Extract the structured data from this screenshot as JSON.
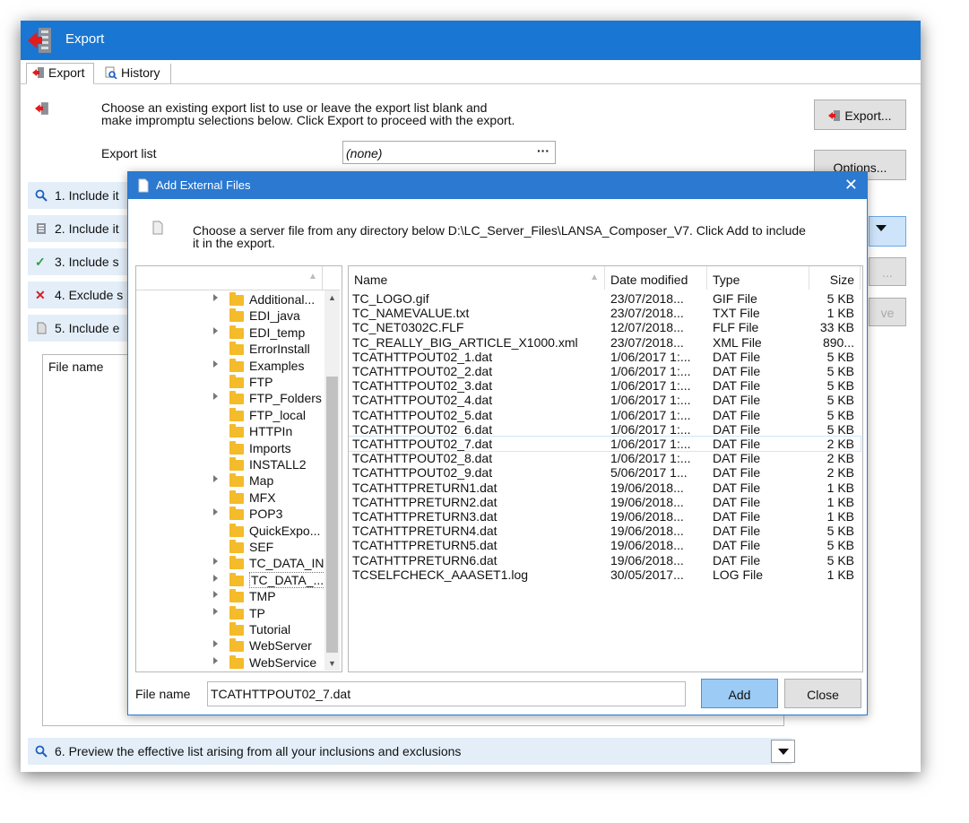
{
  "window": {
    "title": "Export",
    "tabs": [
      {
        "label": "Export"
      },
      {
        "label": "History"
      }
    ],
    "info_line1": "Choose an existing export list to use or leave the export list blank and",
    "info_line2": "make impromptu selections below.  Click Export to proceed with the export.",
    "export_list_label": "Export list",
    "export_list_value": "(none)",
    "export_button": "Export...",
    "options_button": "Options...",
    "sections": [
      {
        "label": "1. Include it",
        "icon": "magnifier-icon"
      },
      {
        "label": "2. Include it",
        "icon": "list-icon"
      },
      {
        "label": "3. Include s",
        "icon": "check-icon"
      },
      {
        "label": "4. Exclude s",
        "icon": "cross-icon"
      },
      {
        "label": "5. Include e",
        "icon": "file-icon"
      }
    ],
    "filelist_header": "File name",
    "preview_section": "6. Preview the effective list arising from all your inclusions and exclusions",
    "partial_button_1": "...",
    "partial_button_2": "ve"
  },
  "dialog": {
    "title": "Add External Files",
    "info_line1": "Choose a server file from any directory below D:\\LC_Server_Files\\LANSA_Composer_V7.  Click Add to include",
    "info_line2": "it in the export.",
    "tree": [
      {
        "name": "Additional...",
        "expandable": true
      },
      {
        "name": "EDI_java",
        "expandable": false
      },
      {
        "name": "EDI_temp",
        "expandable": true
      },
      {
        "name": "ErrorInstall",
        "expandable": false
      },
      {
        "name": "Examples",
        "expandable": true
      },
      {
        "name": "FTP",
        "expandable": false
      },
      {
        "name": "FTP_Folders",
        "expandable": true
      },
      {
        "name": "FTP_local",
        "expandable": false
      },
      {
        "name": "HTTPIn",
        "expandable": false
      },
      {
        "name": "Imports",
        "expandable": false
      },
      {
        "name": "INSTALL2",
        "expandable": false
      },
      {
        "name": "Map",
        "expandable": true
      },
      {
        "name": "MFX",
        "expandable": false
      },
      {
        "name": "POP3",
        "expandable": true
      },
      {
        "name": "QuickExpo...",
        "expandable": false
      },
      {
        "name": "SEF",
        "expandable": false
      },
      {
        "name": "TC_DATA_IN",
        "expandable": true
      },
      {
        "name": "TC_DATA_...",
        "expandable": true,
        "selected": true
      },
      {
        "name": "TMP",
        "expandable": true
      },
      {
        "name": "TP",
        "expandable": true
      },
      {
        "name": "Tutorial",
        "expandable": false
      },
      {
        "name": "WebServer",
        "expandable": true
      },
      {
        "name": "WebService",
        "expandable": true
      }
    ],
    "columns": {
      "name": "Name",
      "date": "Date modified",
      "type": "Type",
      "size": "Size"
    },
    "files": [
      {
        "name": "TC_LOGO.gif",
        "date": "23/07/2018...",
        "type": "GIF File",
        "size": "5 KB"
      },
      {
        "name": "TC_NAMEVALUE.txt",
        "date": "23/07/2018...",
        "type": "TXT File",
        "size": "1 KB"
      },
      {
        "name": "TC_NET0302C.FLF",
        "date": "12/07/2018...",
        "type": "FLF File",
        "size": "33 KB"
      },
      {
        "name": "TC_REALLY_BIG_ARTICLE_X1000.xml",
        "date": "23/07/2018...",
        "type": "XML File",
        "size": "890..."
      },
      {
        "name": "TCATHTTPOUT02_1.dat",
        "date": "1/06/2017 1:...",
        "type": "DAT File",
        "size": "5 KB"
      },
      {
        "name": "TCATHTTPOUT02_2.dat",
        "date": "1/06/2017 1:...",
        "type": "DAT File",
        "size": "5 KB"
      },
      {
        "name": "TCATHTTPOUT02_3.dat",
        "date": "1/06/2017 1:...",
        "type": "DAT File",
        "size": "5 KB"
      },
      {
        "name": "TCATHTTPOUT02_4.dat",
        "date": "1/06/2017 1:...",
        "type": "DAT File",
        "size": "5 KB"
      },
      {
        "name": "TCATHTTPOUT02_5.dat",
        "date": "1/06/2017 1:...",
        "type": "DAT File",
        "size": "5 KB"
      },
      {
        "name": "TCATHTTPOUT02_6.dat",
        "date": "1/06/2017 1:...",
        "type": "DAT File",
        "size": "5 KB"
      },
      {
        "name": "TCATHTTPOUT02_7.dat",
        "date": "1/06/2017 1:...",
        "type": "DAT File",
        "size": "2 KB",
        "selected": true
      },
      {
        "name": "TCATHTTPOUT02_8.dat",
        "date": "1/06/2017 1:...",
        "type": "DAT File",
        "size": "2 KB"
      },
      {
        "name": "TCATHTTPOUT02_9.dat",
        "date": "5/06/2017 1...",
        "type": "DAT File",
        "size": "2 KB"
      },
      {
        "name": "TCATHTTPRETURN1.dat",
        "date": "19/06/2018...",
        "type": "DAT File",
        "size": "1 KB"
      },
      {
        "name": "TCATHTTPRETURN2.dat",
        "date": "19/06/2018...",
        "type": "DAT File",
        "size": "1 KB"
      },
      {
        "name": "TCATHTTPRETURN3.dat",
        "date": "19/06/2018...",
        "type": "DAT File",
        "size": "1 KB"
      },
      {
        "name": "TCATHTTPRETURN4.dat",
        "date": "19/06/2018...",
        "type": "DAT File",
        "size": "5 KB"
      },
      {
        "name": "TCATHTTPRETURN5.dat",
        "date": "19/06/2018...",
        "type": "DAT File",
        "size": "5 KB"
      },
      {
        "name": "TCATHTTPRETURN6.dat",
        "date": "19/06/2018...",
        "type": "DAT File",
        "size": "5 KB"
      },
      {
        "name": "TCSELFCHECK_AAASET1.log",
        "date": "30/05/2017...",
        "type": "LOG File",
        "size": "1 KB"
      }
    ],
    "file_name_label": "File name",
    "file_name_value": "TCATHTTPOUT02_7.dat",
    "add_button": "Add",
    "close_button": "Close"
  },
  "colors": {
    "titlebar": "#1977d3",
    "dialog_title": "#2b79d0",
    "section_bg": "#e3eef9",
    "add_button": "#9ccbf5",
    "folder": "#f4bb2a"
  }
}
